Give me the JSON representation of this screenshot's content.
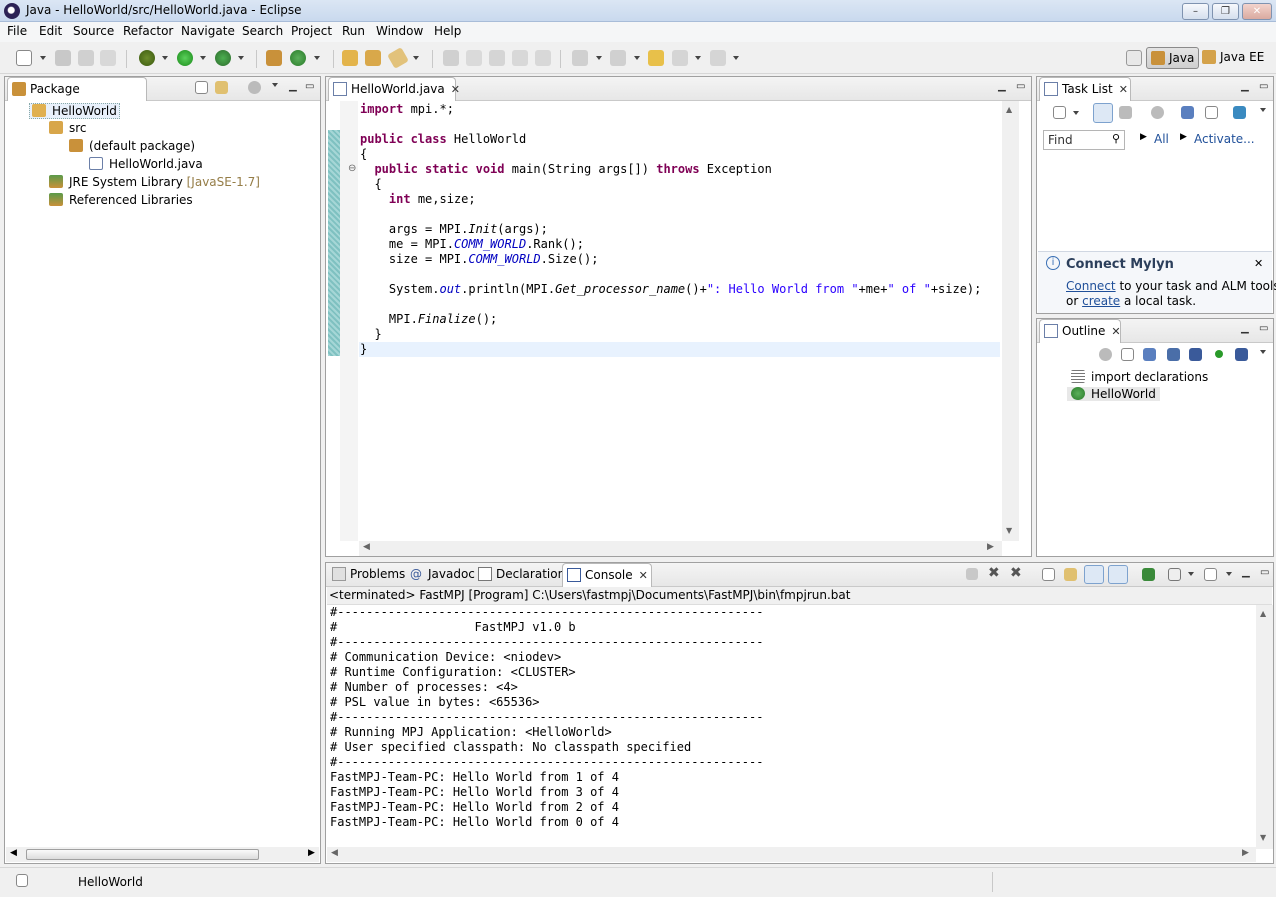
{
  "window": {
    "title": "Java - HelloWorld/src/HelloWorld.java - Eclipse",
    "minimize": "–",
    "maximize": "❐",
    "close": "✕"
  },
  "menu": [
    "File",
    "Edit",
    "Source",
    "Refactor",
    "Navigate",
    "Search",
    "Project",
    "Run",
    "Window",
    "Help"
  ],
  "perspectives": {
    "java": "Java",
    "javaee": "Java EE"
  },
  "package_explorer": {
    "tab": "Package Explorer",
    "items": [
      "HelloWorld",
      "src",
      "(default package)",
      "HelloWorld.java",
      "JRE System Library",
      "[JavaSE-1.7]",
      "Referenced Libraries"
    ]
  },
  "editor": {
    "tab": "HelloWorld.java",
    "lines": {
      "l1_kw": "import",
      "l1_rest": " mpi.*;",
      "l3_kw": "public class",
      "l3_rest": " HelloWorld",
      "l4": "{",
      "l5_kw": "public static void",
      "l5_mid": " main(String args[]) ",
      "l5_kw2": "throws",
      "l5_rest": " Exception",
      "l6": "{",
      "l7_kw": "int",
      "l7_rest": " me,size;",
      "l9_a": "args = MPI.",
      "l9_b": "Init",
      "l9_c": "(args);",
      "l10_a": "me = MPI.",
      "l10_b": "COMM_WORLD",
      "l10_c": ".Rank();",
      "l11_a": "size = MPI.",
      "l11_b": "COMM_WORLD",
      "l11_c": ".Size();",
      "l13_a": "System.",
      "l13_b": "out",
      "l13_c": ".println(MPI.",
      "l13_d": "Get_processor_name",
      "l13_e": "()+",
      "l13_f": "\": Hello World from \"",
      "l13_g": "+me+",
      "l13_h": "\" of \"",
      "l13_i": "+size);",
      "l15_a": "MPI.",
      "l15_b": "Finalize",
      "l15_c": "();",
      "l16": "}",
      "l17": "}"
    }
  },
  "task_list": {
    "tab": "Task List",
    "find_placeholder": "Find",
    "all": "All",
    "activate": "Activate..."
  },
  "mylyn": {
    "title": "Connect Mylyn",
    "connect": "Connect",
    "text1": " to your task and ALM tools",
    "text2a": "or ",
    "create": "create",
    "text2b": " a local task."
  },
  "outline": {
    "tab": "Outline",
    "items": [
      "import declarations",
      "HelloWorld"
    ]
  },
  "bottom_tabs": [
    "Problems",
    "Javadoc",
    "Declaration",
    "Console"
  ],
  "console": {
    "header": "<terminated> FastMPJ [Program] C:\\Users\\fastmpj\\Documents\\FastMPJ\\bin\\fmpjrun.bat",
    "lines": [
      "#-----------------------------------------------------------",
      "#                   FastMPJ v1.0 b",
      "#-----------------------------------------------------------",
      "# Communication Device: <niodev>",
      "# Runtime Configuration: <CLUSTER>",
      "# Number of processes: <4>",
      "# PSL value in bytes: <65536>",
      "#-----------------------------------------------------------",
      "# Running MPJ Application: <HelloWorld>",
      "# User specified classpath: No classpath specified",
      "#-----------------------------------------------------------",
      "FastMPJ-Team-PC: Hello World from 1 of 4",
      "FastMPJ-Team-PC: Hello World from 3 of 4",
      "FastMPJ-Team-PC: Hello World from 2 of 4",
      "FastMPJ-Team-PC: Hello World from 0 of 4"
    ]
  },
  "status": {
    "text": "HelloWorld"
  },
  "colors": {
    "keyword": "#7f0055",
    "string": "#2a00ff",
    "field": "#0000c0",
    "link": "#1f4f99"
  }
}
